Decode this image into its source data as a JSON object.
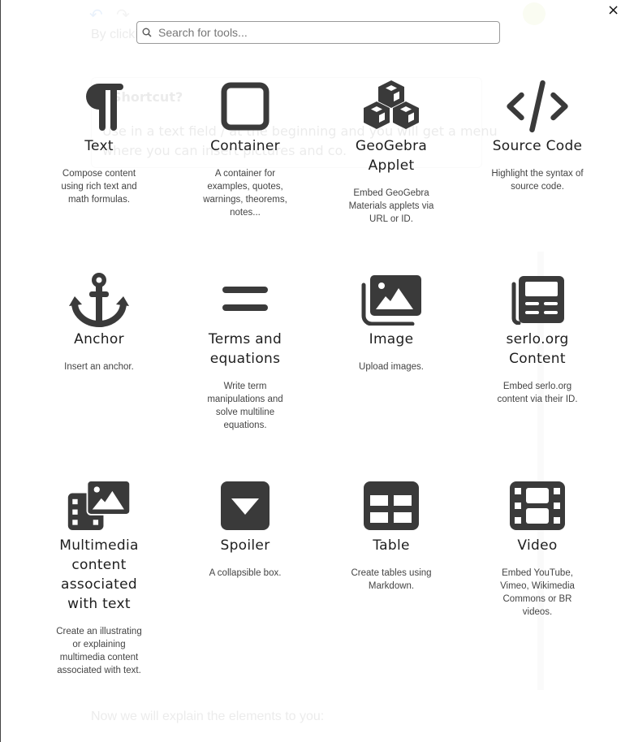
{
  "background": {
    "intro_text": "By clicking on the plus symbol you can add elements in text fields.",
    "box_title": "Shortcut?",
    "box_text": "Use in a text field / at the beginning and you will get a menu where you can insert pictures and co.",
    "bottom_text": "Now we will explain the elements to you:"
  },
  "close_label": "×",
  "search": {
    "placeholder": "Search for tools..."
  },
  "tools": [
    {
      "id": "text",
      "icon": "pilcrow-icon",
      "title": "Text",
      "description": "Compose content using rich text and math formulas."
    },
    {
      "id": "container",
      "icon": "square-outline-icon",
      "title": "Container",
      "description": "A container for examples, quotes, warnings, theorems, notes..."
    },
    {
      "id": "geogebra",
      "icon": "cubes-icon",
      "title": "GeoGebra Applet",
      "description": "Embed GeoGebra Materials applets via URL or ID."
    },
    {
      "id": "source-code",
      "icon": "code-icon",
      "title": "Source Code",
      "description": "Highlight the syntax of source code."
    },
    {
      "id": "anchor",
      "icon": "anchor-icon",
      "title": "Anchor",
      "description": "Insert an anchor."
    },
    {
      "id": "equations",
      "icon": "equals-icon",
      "title": "Terms and equations",
      "description": "Write term manipulations and solve multiline equations."
    },
    {
      "id": "image",
      "icon": "images-icon",
      "title": "Image",
      "description": "Upload images."
    },
    {
      "id": "serlo-content",
      "icon": "newspaper-icon",
      "title": "serlo.org Content",
      "description": "Embed serlo.org content via their ID."
    },
    {
      "id": "multimedia",
      "icon": "photo-film-icon",
      "title": "Multimedia content associated with text",
      "description": "Create an illustrating or explaining multimedia content associated with text."
    },
    {
      "id": "spoiler",
      "icon": "caret-square-down-icon",
      "title": "Spoiler",
      "description": "A collapsible box."
    },
    {
      "id": "table",
      "icon": "table-icon",
      "title": "Table",
      "description": "Create tables using Markdown."
    },
    {
      "id": "video",
      "icon": "film-icon",
      "title": "Video",
      "description": "Embed YouTube, Vimeo, Wikimedia Commons or BR videos."
    }
  ],
  "colors": {
    "icon": "#3a3a3a",
    "text": "#1e1e1e",
    "description": "#444444"
  }
}
